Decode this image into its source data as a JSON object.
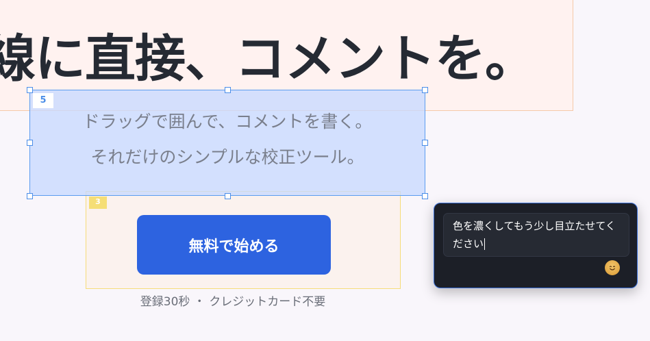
{
  "hero": {
    "title": "線に直接、コメントを。"
  },
  "selection": {
    "badge": "5",
    "subtitle_line1": "ドラッグで囲んで、コメントを書く。",
    "subtitle_line2": "それだけのシンプルな校正ツール。"
  },
  "cta": {
    "badge": "3",
    "button_label": "無料で始める",
    "note": "登録30秒 ・ クレジットカード不要"
  },
  "comment": {
    "text": "色を濃くしてもう少し目立たせてください",
    "emoji_icon": "smile-emoji-icon"
  },
  "colors": {
    "accent": "#2d63e0",
    "selection_border": "#4a8de8",
    "popup_bg": "#1c1f27"
  }
}
